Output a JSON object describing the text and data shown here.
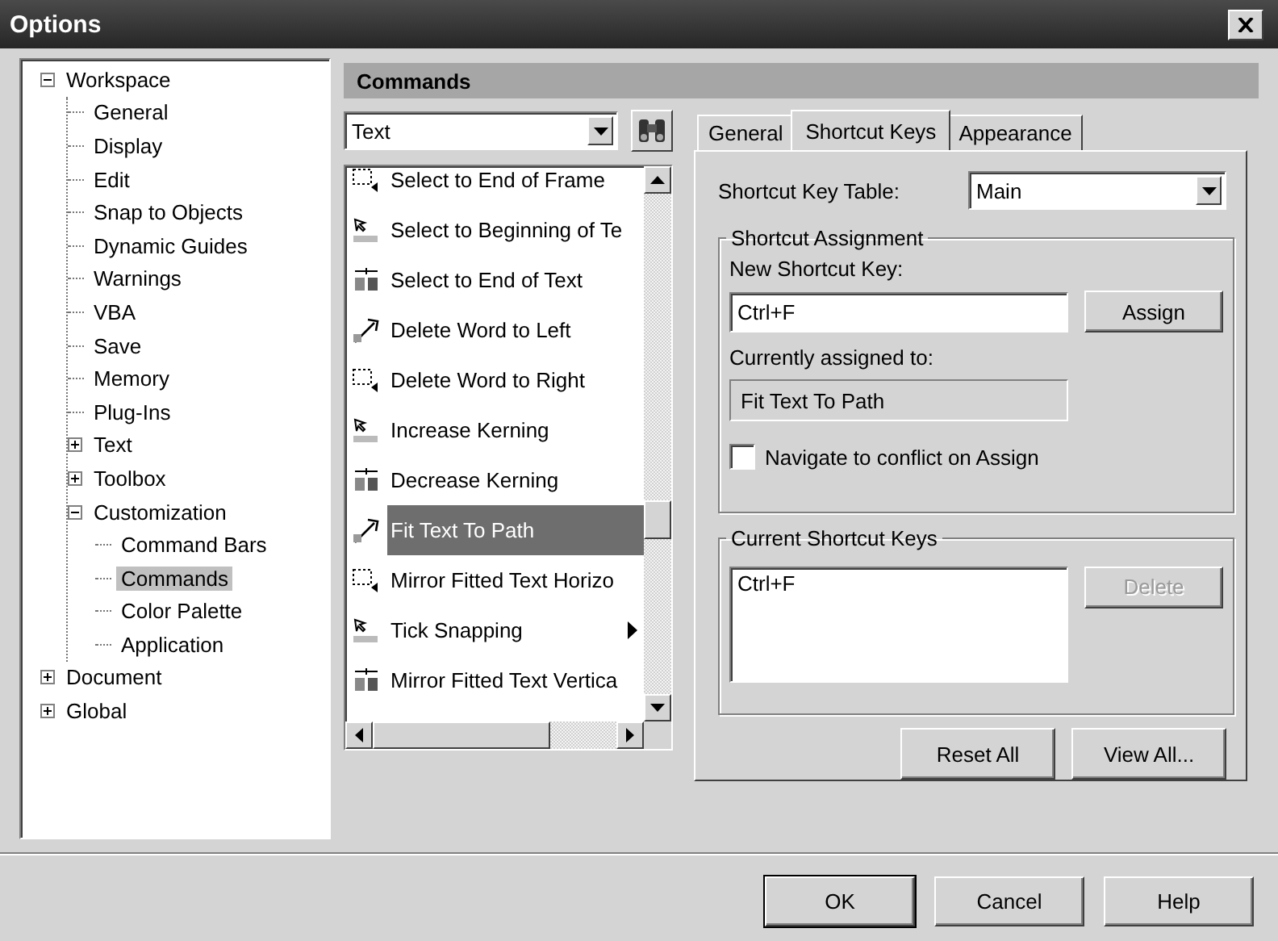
{
  "window": {
    "title": "Options"
  },
  "tree": [
    {
      "label": "Workspace",
      "expanded": true,
      "selected": false,
      "children": [
        {
          "label": "General",
          "selected": false
        },
        {
          "label": "Display",
          "selected": false
        },
        {
          "label": "Edit",
          "selected": false
        },
        {
          "label": "Snap to Objects",
          "selected": false
        },
        {
          "label": "Dynamic Guides",
          "selected": false
        },
        {
          "label": "Warnings",
          "selected": false
        },
        {
          "label": "VBA",
          "selected": false
        },
        {
          "label": "Save",
          "selected": false
        },
        {
          "label": "Memory",
          "selected": false
        },
        {
          "label": "Plug-Ins",
          "selected": false
        },
        {
          "label": "Text",
          "expanded": false,
          "selected": false
        },
        {
          "label": "Toolbox",
          "expanded": false,
          "selected": false
        },
        {
          "label": "Customization",
          "expanded": true,
          "selected": false,
          "children": [
            {
              "label": "Command Bars",
              "selected": false
            },
            {
              "label": "Commands",
              "selected": true
            },
            {
              "label": "Color Palette",
              "selected": false
            },
            {
              "label": "Application",
              "selected": false
            }
          ]
        }
      ]
    },
    {
      "label": "Document",
      "expanded": false,
      "selected": false
    },
    {
      "label": "Global",
      "expanded": false,
      "selected": false
    }
  ],
  "section_header": "Commands",
  "category_dropdown": {
    "value": "Text"
  },
  "commands": [
    {
      "label": "Select to End of Frame",
      "selected": false,
      "submenu": false
    },
    {
      "label": "Select to Beginning of Te",
      "selected": false,
      "submenu": false
    },
    {
      "label": "Select to End of Text",
      "selected": false,
      "submenu": false
    },
    {
      "label": "Delete Word to Left",
      "selected": false,
      "submenu": false
    },
    {
      "label": "Delete Word to Right",
      "selected": false,
      "submenu": false
    },
    {
      "label": "Increase Kerning",
      "selected": false,
      "submenu": false
    },
    {
      "label": "Decrease Kerning",
      "selected": false,
      "submenu": false
    },
    {
      "label": "Fit Text To Path",
      "selected": true,
      "submenu": false
    },
    {
      "label": "Mirror Fitted Text Horizo",
      "selected": false,
      "submenu": false
    },
    {
      "label": "Tick Snapping",
      "selected": false,
      "submenu": true
    },
    {
      "label": "Mirror Fitted Text Vertica",
      "selected": false,
      "submenu": false
    }
  ],
  "tabs": [
    {
      "label": "General",
      "selected": false
    },
    {
      "label": "Shortcut Keys",
      "selected": true
    },
    {
      "label": "Appearance",
      "selected": false
    }
  ],
  "shortcut_key_table": {
    "label": "Shortcut Key Table:",
    "value": "Main"
  },
  "shortcut_assignment": {
    "title": "Shortcut Assignment",
    "new_shortcut_key": {
      "label": "New Shortcut Key:",
      "value": "Ctrl+F"
    },
    "assign_button": {
      "label": "Assign",
      "disabled": false
    },
    "currently_assigned": {
      "label": "Currently assigned to:",
      "value": "Fit Text To Path"
    },
    "navigate_checkbox": {
      "label": "Navigate to conflict on Assign",
      "checked": false
    }
  },
  "current_shortcut_keys": {
    "title": "Current Shortcut Keys",
    "items": [
      "Ctrl+F"
    ],
    "delete_button": {
      "label": "Delete",
      "disabled": true
    }
  },
  "panel_buttons": [
    {
      "label": "Reset All",
      "disabled": false
    },
    {
      "label": "View All...",
      "disabled": false
    }
  ],
  "dialog_buttons": [
    {
      "label": "OK",
      "disabled": false
    },
    {
      "label": "Cancel",
      "disabled": false
    },
    {
      "label": "Help",
      "disabled": false
    }
  ]
}
